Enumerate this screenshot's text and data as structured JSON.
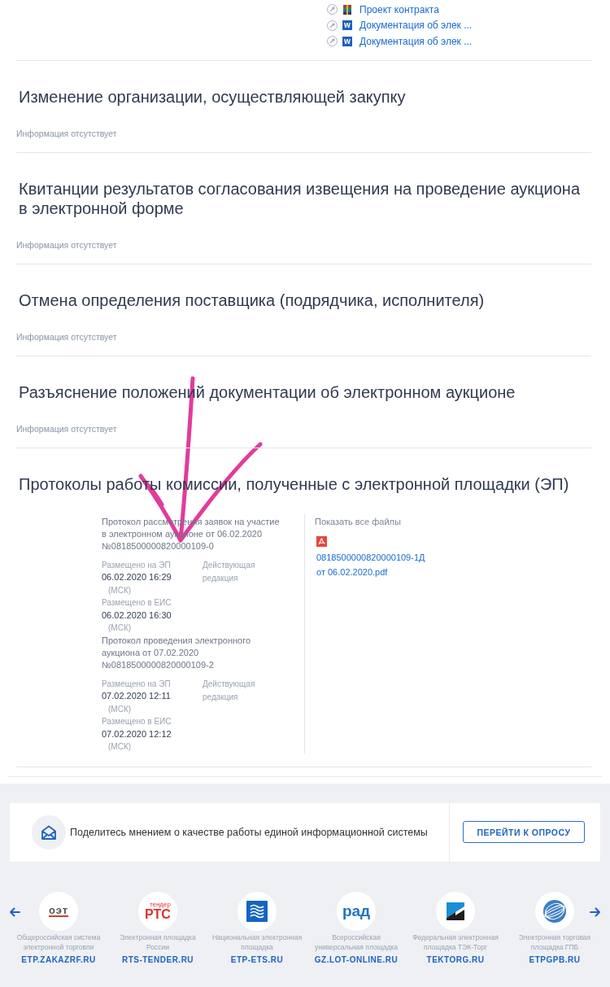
{
  "attachments": [
    {
      "kind": "archive",
      "label": "Проект контракта"
    },
    {
      "kind": "word",
      "badge": "w",
      "label": "Документация об элек ..."
    },
    {
      "kind": "word",
      "badge": "w",
      "label": "Документация об элек ..."
    }
  ],
  "sections": [
    {
      "title": "Изменение организации, осуществляющей закупку",
      "empty_text": "Информация отсутствует"
    },
    {
      "title": "Квитанции результатов согласования извещения на проведение аукциона в электронной форме",
      "empty_text": "Информация отсутствует"
    },
    {
      "title": "Отмена определения поставщика (подрядчика, исполнителя)",
      "empty_text": "Информация отсутствует"
    },
    {
      "title": "Разъяснение положений документации об электронном аукционе",
      "empty_text": "Информация отсутствует"
    },
    {
      "title": "Протоколы работы комиссии, полученные с электронной площадки (ЭП)",
      "protocols": [
        {
          "title": "Протокол рассмотрения заявок на участие в электронном аукционе от 06.02.2020 №0818500000820000109-0",
          "published": [
            {
              "label": "Размещено на ЭП",
              "datetime": "06.02.2020 16:29",
              "timezone": "(МСК)"
            },
            {
              "label": "Размещено в ЕИС",
              "datetime": "06.02.2020 16:30",
              "timezone": "(МСК)"
            }
          ],
          "status": "Действующая редакция"
        },
        {
          "title": "Протокол проведения электронного аукциона от 07.02.2020 №0818500000820000109-2",
          "published": [
            {
              "label": "Размещено на ЭП",
              "datetime": "07.02.2020 12:11",
              "timezone": "(МСК)"
            },
            {
              "label": "Размещено в ЕИС",
              "datetime": "07.02.2020 12:12",
              "timezone": "(МСК)"
            }
          ],
          "status": "Действующая редакция"
        }
      ],
      "files": {
        "show_all": "Показать все файлы",
        "items": [
          {
            "kind": "pdf",
            "name": "0818500000820000109-1Д от 06.02.2020.pdf"
          }
        ]
      }
    }
  ],
  "survey": {
    "text": "Поделитесь мнением о качестве работы единой информационной системы",
    "button": "ПЕРЕЙТИ К ОПРОСУ"
  },
  "platforms": [
    {
      "logo": {
        "kind": "oet",
        "texts": [
          "оэт"
        ]
      },
      "description": "Общероссийская система электронной торговли",
      "domain": "ETP.ZAKAZRF.RU"
    },
    {
      "logo": {
        "kind": "rts",
        "texts": [
          "тендер",
          "РТС"
        ]
      },
      "description": "Электронная площадка России",
      "domain": "RTS-TENDER.RU"
    },
    {
      "logo": {
        "kind": "ets"
      },
      "description": "Национальная электронная площадка",
      "domain": "ETP-ETS.RU"
    },
    {
      "logo": {
        "kind": "rad",
        "texts": [
          "рад"
        ]
      },
      "description": "Всероссийская универсальная площадка",
      "domain": "GZ.LOT-ONLINE.RU"
    },
    {
      "logo": {
        "kind": "tektorg"
      },
      "description": "Федеральная электронная площадка ТЭК-Торг",
      "domain": "TEKTORG.RU"
    },
    {
      "logo": {
        "kind": "gpb"
      },
      "description": "Электронная торговая площадка ГПБ",
      "domain": "ETPGPB.RU"
    }
  ],
  "annotation": {
    "kind": "arrow"
  }
}
